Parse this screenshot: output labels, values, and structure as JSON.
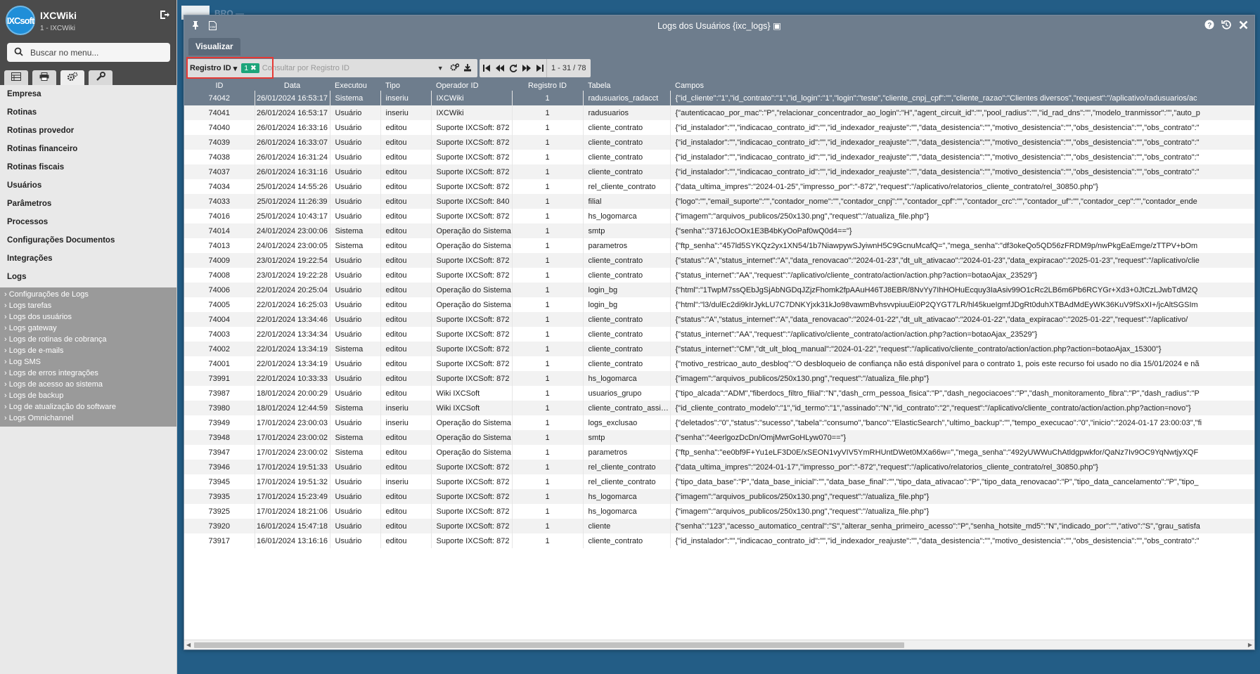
{
  "sidebar": {
    "app_name": "IXCWiki",
    "app_sub": "1 - IXCWiki",
    "logo_text": "IXCsoft",
    "search_placeholder": "Buscar no menu...",
    "menu": [
      "Empresa",
      "Rotinas",
      "Rotinas provedor",
      "Rotinas financeiro",
      "Rotinas fiscais",
      "Usuários",
      "Parâmetros",
      "Processos",
      "Configurações Documentos",
      "Integrações",
      "Logs"
    ],
    "submenu": [
      "Configurações de Logs",
      "Logs tarefas",
      "Logs dos usuários",
      "Logs gateway",
      "Logs de rotinas de cobrança",
      "Logs de e-mails",
      "Log SMS",
      "Logs de erros integrações",
      "Logs de acesso ao sistema",
      "Logs de backup",
      "Log de atualização do software",
      "Logs Omnichannel"
    ]
  },
  "background": {
    "tab_text": "BRO —"
  },
  "window": {
    "title": "Logs dos Usuários {ixc_logs}",
    "tab_label": "Visualizar",
    "filter": {
      "field": "Registro ID",
      "badge": "1",
      "placeholder": "Consultar por Registro ID"
    },
    "pager": "1 - 31 / 78"
  },
  "table": {
    "columns": [
      "ID",
      "Data",
      "Executou",
      "Tipo",
      "Operador ID",
      "Registro ID",
      "Tabela",
      "Campos"
    ],
    "rows": [
      [
        "74042",
        "26/01/2024 16:53:17",
        "Sistema",
        "inseriu",
        "IXCWiki",
        "1",
        "radusuarios_radacct",
        "{\"id_cliente\":\"1\",\"id_contrato\":\"1\",\"id_login\":\"1\",\"login\":\"teste\",\"cliente_cnpj_cpf\":\"\",\"cliente_razao\":\"Clientes diversos\",\"request\":\"/aplicativo/radusuarios/ac"
      ],
      [
        "74041",
        "26/01/2024 16:53:17",
        "Usuário",
        "inseriu",
        "IXCWiki",
        "1",
        "radusuarios",
        "{\"autenticacao_por_mac\":\"P\",\"relacionar_concentrador_ao_login\":\"H\",\"agent_circuit_id\":\"\",\"pool_radius\":\"\",\"id_rad_dns\":\"\",\"modelo_tranmissor\":\"\",\"auto_p"
      ],
      [
        "74040",
        "26/01/2024 16:33:16",
        "Usuário",
        "editou",
        "Suporte IXCSoft: 872",
        "1",
        "cliente_contrato",
        "{\"id_instalador\":\"\",\"indicacao_contrato_id\":\"\",\"id_indexador_reajuste\":\"\",\"data_desistencia\":\"\",\"motivo_desistencia\":\"\",\"obs_desistencia\":\"\",\"obs_contrato\":\""
      ],
      [
        "74039",
        "26/01/2024 16:33:07",
        "Usuário",
        "editou",
        "Suporte IXCSoft: 872",
        "1",
        "cliente_contrato",
        "{\"id_instalador\":\"\",\"indicacao_contrato_id\":\"\",\"id_indexador_reajuste\":\"\",\"data_desistencia\":\"\",\"motivo_desistencia\":\"\",\"obs_desistencia\":\"\",\"obs_contrato\":\""
      ],
      [
        "74038",
        "26/01/2024 16:31:24",
        "Usuário",
        "editou",
        "Suporte IXCSoft: 872",
        "1",
        "cliente_contrato",
        "{\"id_instalador\":\"\",\"indicacao_contrato_id\":\"\",\"id_indexador_reajuste\":\"\",\"data_desistencia\":\"\",\"motivo_desistencia\":\"\",\"obs_desistencia\":\"\",\"obs_contrato\":\""
      ],
      [
        "74037",
        "26/01/2024 16:31:16",
        "Usuário",
        "editou",
        "Suporte IXCSoft: 872",
        "1",
        "cliente_contrato",
        "{\"id_instalador\":\"\",\"indicacao_contrato_id\":\"\",\"id_indexador_reajuste\":\"\",\"data_desistencia\":\"\",\"motivo_desistencia\":\"\",\"obs_desistencia\":\"\",\"obs_contrato\":\""
      ],
      [
        "74034",
        "25/01/2024 14:55:26",
        "Usuário",
        "editou",
        "Suporte IXCSoft: 872",
        "1",
        "rel_cliente_contrato",
        "{\"data_ultima_impres\":\"2024-01-25\",\"impresso_por\":\"-872\",\"request\":\"/aplicativo/relatorios_cliente_contrato/rel_30850.php\"}"
      ],
      [
        "74033",
        "25/01/2024 11:26:39",
        "Usuário",
        "editou",
        "Suporte IXCSoft: 840",
        "1",
        "filial",
        "{\"logo\":\"\",\"email_suporte\":\"\",\"contador_nome\":\"\",\"contador_cnpj\":\"\",\"contador_cpf\":\"\",\"contador_crc\":\"\",\"contador_uf\":\"\",\"contador_cep\":\"\",\"contador_ende"
      ],
      [
        "74016",
        "25/01/2024 10:43:17",
        "Usuário",
        "editou",
        "Suporte IXCSoft: 872",
        "1",
        "hs_logomarca",
        "{\"imagem\":\"arquivos_publicos/250x130.png\",\"request\":\"/atualiza_file.php\"}"
      ],
      [
        "74014",
        "24/01/2024 23:00:06",
        "Sistema",
        "editou",
        "Operação do Sistema",
        "1",
        "smtp",
        "{\"senha\":\"3716JcOOx1E3B4bKyOoPaf0wQ0d4==\"}"
      ],
      [
        "74013",
        "24/01/2024 23:00:05",
        "Sistema",
        "editou",
        "Operação do Sistema",
        "1",
        "parametros",
        "{\"ftp_senha\":\"457ld5SYKQz2yx1XN54/1b7NiawpywSJyiwnH5C9GcnuMcafQ=\",\"mega_senha\":\"df3okeQo5QD56zFRDM9p/nwPkgEaEmge/zTTPV+bOm"
      ],
      [
        "74009",
        "23/01/2024 19:22:54",
        "Usuário",
        "editou",
        "Suporte IXCSoft: 872",
        "1",
        "cliente_contrato",
        "{\"status\":\"A\",\"status_internet\":\"A\",\"data_renovacao\":\"2024-01-23\",\"dt_ult_ativacao\":\"2024-01-23\",\"data_expiracao\":\"2025-01-23\",\"request\":\"/aplicativo/clie"
      ],
      [
        "74008",
        "23/01/2024 19:22:28",
        "Usuário",
        "editou",
        "Suporte IXCSoft: 872",
        "1",
        "cliente_contrato",
        "{\"status_internet\":\"AA\",\"request\":\"/aplicativo/cliente_contrato/action/action.php?action=botaoAjax_23529\"}"
      ],
      [
        "74006",
        "22/01/2024 20:25:04",
        "Usuário",
        "editou",
        "Operação do Sistema",
        "1",
        "login_bg",
        "{\"html\":\"1TwpM7ssQEbJgSjAbNGDqJZjzFhomk2fpAAuH46TJ8EBR/8NvYy7IhHOHuEcquy3IaAsiv99O1cRc2LB6m6Pb6RCYGr+Xd3+0JtCzLJwbTdM2Q"
      ],
      [
        "74005",
        "22/01/2024 16:25:03",
        "Usuário",
        "editou",
        "Operação do Sistema",
        "1",
        "login_bg",
        "{\"html\":\"l3/dulEc2di9kIrJykLU7C7DNKYjxk31kJo98vawmBvhsvvpiuuEi0P2QYGT7LR/hl45kueIgmfJDgRt0duhXTBAdMdEyWK36KuV9fSxXI+/jcAltSGSIm"
      ],
      [
        "74004",
        "22/01/2024 13:34:46",
        "Usuário",
        "editou",
        "Suporte IXCSoft: 872",
        "1",
        "cliente_contrato",
        "{\"status\":\"A\",\"status_internet\":\"A\",\"data_renovacao\":\"2024-01-22\",\"dt_ult_ativacao\":\"2024-01-22\",\"data_expiracao\":\"2025-01-22\",\"request\":\"/aplicativo/"
      ],
      [
        "74003",
        "22/01/2024 13:34:34",
        "Usuário",
        "editou",
        "Suporte IXCSoft: 872",
        "1",
        "cliente_contrato",
        "{\"status_internet\":\"AA\",\"request\":\"/aplicativo/cliente_contrato/action/action.php?action=botaoAjax_23529\"}"
      ],
      [
        "74002",
        "22/01/2024 13:34:19",
        "Sistema",
        "editou",
        "Suporte IXCSoft: 872",
        "1",
        "cliente_contrato",
        "{\"status_internet\":\"CM\",\"dt_ult_bloq_manual\":\"2024-01-22\",\"request\":\"/aplicativo/cliente_contrato/action/action.php?action=botaoAjax_15300\"}"
      ],
      [
        "74001",
        "22/01/2024 13:34:19",
        "Usuário",
        "editou",
        "Suporte IXCSoft: 872",
        "1",
        "cliente_contrato",
        "{\"motivo_restricao_auto_desbloq\":\"O desbloqueio de confiança não está disponível para o contrato 1, pois este recurso foi usado no dia 15/01/2024 e nã"
      ],
      [
        "73991",
        "22/01/2024 10:33:33",
        "Usuário",
        "editou",
        "Suporte IXCSoft: 872",
        "1",
        "hs_logomarca",
        "{\"imagem\":\"arquivos_publicos/250x130.png\",\"request\":\"/atualiza_file.php\"}"
      ],
      [
        "73987",
        "18/01/2024 20:00:29",
        "Usuário",
        "editou",
        "Wiki IXCSoft",
        "1",
        "usuarios_grupo",
        "{\"tipo_alcada\":\"ADM\",\"fiberdocs_filtro_filial\":\"N\",\"dash_crm_pessoa_fisica\":\"P\",\"dash_negociacoes\":\"P\",\"dash_monitoramento_fibra\":\"P\",\"dash_radius\":\"P"
      ],
      [
        "73980",
        "18/01/2024 12:44:59",
        "Sistema",
        "inseriu",
        "Wiki IXCSoft",
        "1",
        "cliente_contrato_assinatura",
        "{\"id_cliente_contrato_modelo\":\"1\",\"id_termo\":\"1\",\"assinado\":\"N\",\"id_contrato\":\"2\",\"request\":\"/aplicativo/cliente_contrato/action/action.php?action=novo\"}"
      ],
      [
        "73949",
        "17/01/2024 23:00:03",
        "Usuário",
        "inseriu",
        "Operação do Sistema",
        "1",
        "logs_exclusao",
        "{\"deletados\":\"0\",\"status\":\"sucesso\",\"tabela\":\"consumo\",\"banco\":\"ElasticSearch\",\"ultimo_backup\":\"\",\"tempo_execucao\":\"0\",\"inicio\":\"2024-01-17 23:00:03\",\"fi"
      ],
      [
        "73948",
        "17/01/2024 23:00:02",
        "Sistema",
        "editou",
        "Operação do Sistema",
        "1",
        "smtp",
        "{\"senha\":\"4eerlgozDcDn/OmjMwrGoHLyw070==\"}"
      ],
      [
        "73947",
        "17/01/2024 23:00:02",
        "Sistema",
        "editou",
        "Operação do Sistema",
        "1",
        "parametros",
        "{\"ftp_senha\":\"ee0bf9F+Yu1eLF3D0E/xSEON1vyVIV5YmRHUntDWet0MXa66w=\",\"mega_senha\":\"492yUWWuChAtldgpwkfor/QaNz7Iv9OC9YqNwtjyXQF"
      ],
      [
        "73946",
        "17/01/2024 19:51:33",
        "Usuário",
        "editou",
        "Suporte IXCSoft: 872",
        "1",
        "rel_cliente_contrato",
        "{\"data_ultima_impres\":\"2024-01-17\",\"impresso_por\":\"-872\",\"request\":\"/aplicativo/relatorios_cliente_contrato/rel_30850.php\"}"
      ],
      [
        "73945",
        "17/01/2024 19:51:32",
        "Usuário",
        "inseriu",
        "Suporte IXCSoft: 872",
        "1",
        "rel_cliente_contrato",
        "{\"tipo_data_base\":\"P\",\"data_base_inicial\":\"\",\"data_base_final\":\"\",\"tipo_data_ativacao\":\"P\",\"tipo_data_renovacao\":\"P\",\"tipo_data_cancelamento\":\"P\",\"tipo_"
      ],
      [
        "73935",
        "17/01/2024 15:23:49",
        "Usuário",
        "editou",
        "Suporte IXCSoft: 872",
        "1",
        "hs_logomarca",
        "{\"imagem\":\"arquivos_publicos/250x130.png\",\"request\":\"/atualiza_file.php\"}"
      ],
      [
        "73925",
        "17/01/2024 18:21:06",
        "Usuário",
        "editou",
        "Suporte IXCSoft: 872",
        "1",
        "hs_logomarca",
        "{\"imagem\":\"arquivos_publicos/250x130.png\",\"request\":\"/atualiza_file.php\"}"
      ],
      [
        "73920",
        "16/01/2024 15:47:18",
        "Usuário",
        "editou",
        "Suporte IXCSoft: 872",
        "1",
        "cliente",
        "{\"senha\":\"123\",\"acesso_automatico_central\":\"S\",\"alterar_senha_primeiro_acesso\":\"P\",\"senha_hotsite_md5\":\"N\",\"indicado_por\":\"\",\"ativo\":\"S\",\"grau_satisfa"
      ],
      [
        "73917",
        "16/01/2024 13:16:16",
        "Usuário",
        "editou",
        "Suporte IXCSoft: 872",
        "1",
        "cliente_contrato",
        "{\"id_instalador\":\"\",\"indicacao_contrato_id\":\"\",\"id_indexador_reajuste\":\"\",\"data_desistencia\":\"\",\"motivo_desistencia\":\"\",\"obs_desistencia\":\"\",\"obs_contrato\":\""
      ]
    ]
  },
  "colors": {
    "window_header": "#6e7d8d",
    "sidebar_header": "#4b4b4b",
    "desktop": "#235d86",
    "highlight": "#e53935",
    "badge": "#1da57a"
  },
  "icons": {
    "sidebar_tabs": [
      "table-icon",
      "print-icon",
      "gears-icon",
      "wrench-icon"
    ]
  }
}
